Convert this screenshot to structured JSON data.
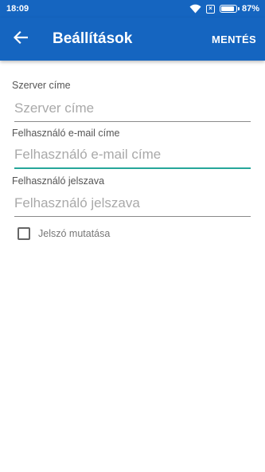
{
  "status_bar": {
    "time": "18:09",
    "battery_percent": "87%",
    "battery_level": 0.87,
    "icons": [
      "wifi-icon",
      "sim-x-icon",
      "battery-icon"
    ]
  },
  "toolbar": {
    "title": "Beállítások",
    "save_label": "MENTÉS",
    "back_icon": "arrow-left-icon"
  },
  "form": {
    "server": {
      "label": "Szerver címe",
      "placeholder": "Szerver címe",
      "value": ""
    },
    "email": {
      "label": "Felhasználó e-mail címe",
      "placeholder": "Felhasználó e-mail címe",
      "value": ""
    },
    "password": {
      "label": "Felhasználó jelszava",
      "placeholder": "Felhasználó jelszava",
      "value": ""
    },
    "show_password": {
      "label": "Jelszó mutatása",
      "checked": false
    }
  },
  "colors": {
    "primary": "#1565c0",
    "accent": "#26a69a"
  }
}
